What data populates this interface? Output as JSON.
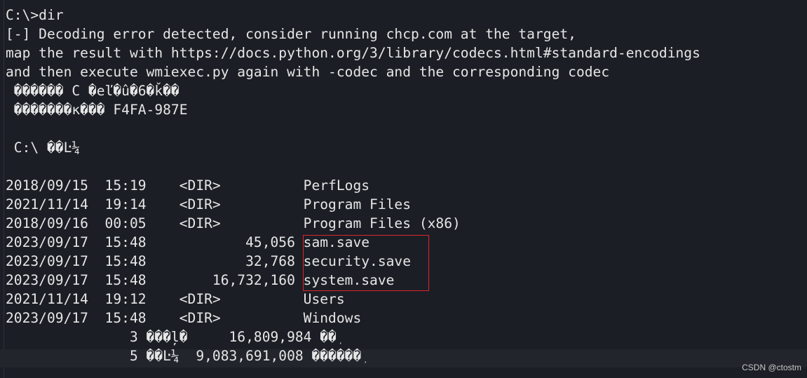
{
  "terminal": {
    "lines": [
      "C:\\>dir",
      "[-] Decoding error detected, consider running chcp.com at the target,",
      "map the result with https://docs.python.org/3/library/codecs.html#standard-encodings",
      "and then execute wmiexec.py again with -codec and the corresponding codec",
      " ������ C �eľ�û�6�ǩ��",
      " �������к��� F4FA-987E",
      "",
      " C:\\ ��Ŀ¼",
      "",
      "2018/09/15  15:19    <DIR>          PerfLogs",
      "2021/11/14  19:14    <DIR>          Program Files",
      "2018/09/16  00:05    <DIR>          Program Files (x86)",
      "2023/09/17  15:48            45,056 sam.save",
      "2023/09/17  15:48            32,768 security.save",
      "2023/09/17  15:48        16,732,160 system.save",
      "2021/11/14  19:12    <DIR>          Users",
      "2023/09/17  15:48    <DIR>          Windows",
      "               3 ���ļ�     16,809,984 ��ֽ",
      "               5 ��Ŀ¼  9,083,691,008 ������ֽ"
    ]
  },
  "highlight_color": "#e0242a",
  "watermark": "CSDN @ctostm"
}
